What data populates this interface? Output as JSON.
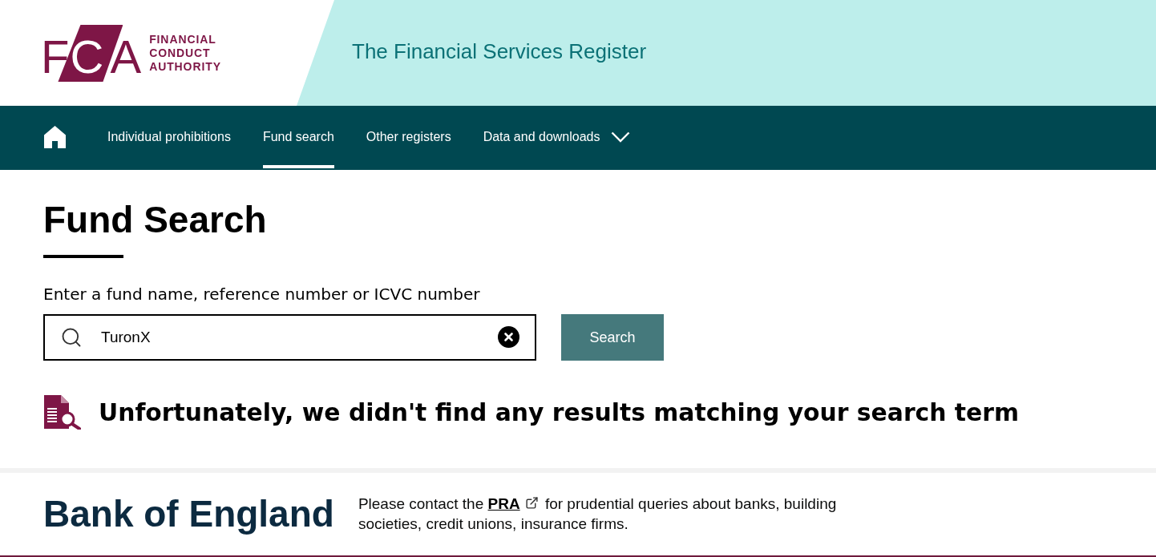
{
  "header": {
    "logo": {
      "letters": [
        {
          "char": "F",
          "on_shape": false
        },
        {
          "char": "C",
          "on_shape": true
        },
        {
          "char": "A",
          "on_shape": false
        }
      ],
      "name_lines": [
        "FINANCIAL",
        "CONDUCT",
        "AUTHORITY"
      ]
    },
    "title": "The Financial Services Register"
  },
  "nav": {
    "items": [
      {
        "label": "Individual prohibitions",
        "kind": "link",
        "selected": false
      },
      {
        "label": "Fund search",
        "kind": "link",
        "selected": true
      },
      {
        "label": "Other registers",
        "kind": "link",
        "selected": false
      },
      {
        "label": "Data and downloads",
        "kind": "dropdown",
        "selected": false
      }
    ]
  },
  "main": {
    "heading": "Fund Search",
    "search": {
      "label": "Enter a fund name, reference number or ICVC number",
      "value": "TuronX",
      "button": "Search"
    },
    "message": "Unfortunately, we didn't find any results matching your search term"
  },
  "footer": {
    "brand": "Bank of England",
    "notice": {
      "before": "Please contact the",
      "link": "PRA",
      "after": "for prudential queries about banks, building societies, credit unions, insurance firms."
    }
  }
}
